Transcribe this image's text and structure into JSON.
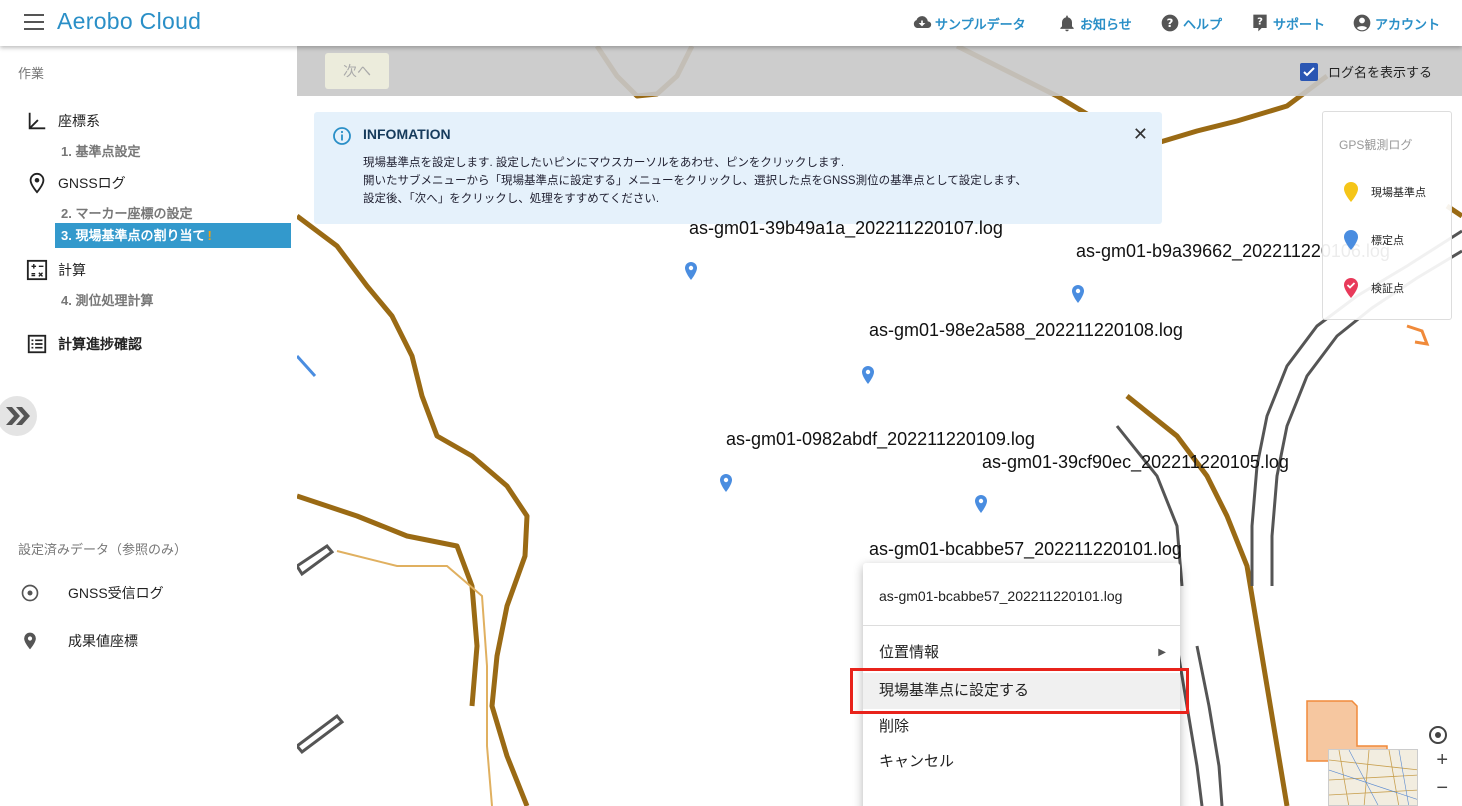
{
  "header": {
    "title": "Aerobo Cloud",
    "nav": {
      "sample": "サンプルデータ",
      "notice": "お知らせ",
      "help": "ヘルプ",
      "support": "サポート",
      "account": "アカウント"
    }
  },
  "sidebar": {
    "work_label": "作業",
    "coord": {
      "title": "座標系",
      "step1": "1. 基準点設定"
    },
    "gnss": {
      "title": "GNSSログ",
      "step2": "2. マーカー座標の設定",
      "step3": "3. 現場基準点の割り当て",
      "warn": "!"
    },
    "calc": {
      "title": "計算",
      "step4": "4. 測位処理計算"
    },
    "progress": "計算進捗確認",
    "ref_label": "設定済みデータ（参照のみ）",
    "ref_items": {
      "gnss_log": "GNSS受信ログ",
      "result": "成果値座標"
    }
  },
  "toolbar": {
    "next": "次へ",
    "show_log_names": "ログ名を表示する",
    "show_log_checked": true
  },
  "info": {
    "title": "INFOMATION",
    "line1": "現場基準点を設定します. 設定したいピンにマウスカーソルをあわせ、ピンをクリックします.",
    "line2": "開いたサブメニューから「現場基準点に設定する」メニューをクリックし、選択した点をGNSS測位の基準点として設定します、",
    "line3": "設定後、「次へ」をクリックし、処理をすすめてください."
  },
  "legend": {
    "title": "GPS観測ログ",
    "items": [
      {
        "label": "現場基準点",
        "color": "#f5c518"
      },
      {
        "label": "標定点",
        "color": "#4a8de0"
      },
      {
        "label": "検証点",
        "color": "#e83a5a"
      }
    ]
  },
  "logs": [
    "as-gm01-39b49a1a_202211220107.log",
    "as-gm01-b9a39662_202211220106.log",
    "as-gm01-98e2a588_202211220108.log",
    "as-gm01-0982abdf_202211220109.log",
    "as-gm01-39cf90ec_202211220105.log",
    "as-gm01-bcabbe57_202211220101.log"
  ],
  "context_menu": {
    "header": "as-gm01-bcabbe57_202211220101.log",
    "items": {
      "position": "位置情報",
      "set_base": "現場基準点に設定する",
      "delete": "削除",
      "cancel": "キャンセル"
    }
  },
  "map_controls": {
    "zoom_in": "+",
    "zoom_out": "−"
  },
  "colors": {
    "accent": "#2a8fc7",
    "active_step": "#3399cc",
    "highlight": "#e8231b",
    "road_brown": "#9a6a14"
  }
}
